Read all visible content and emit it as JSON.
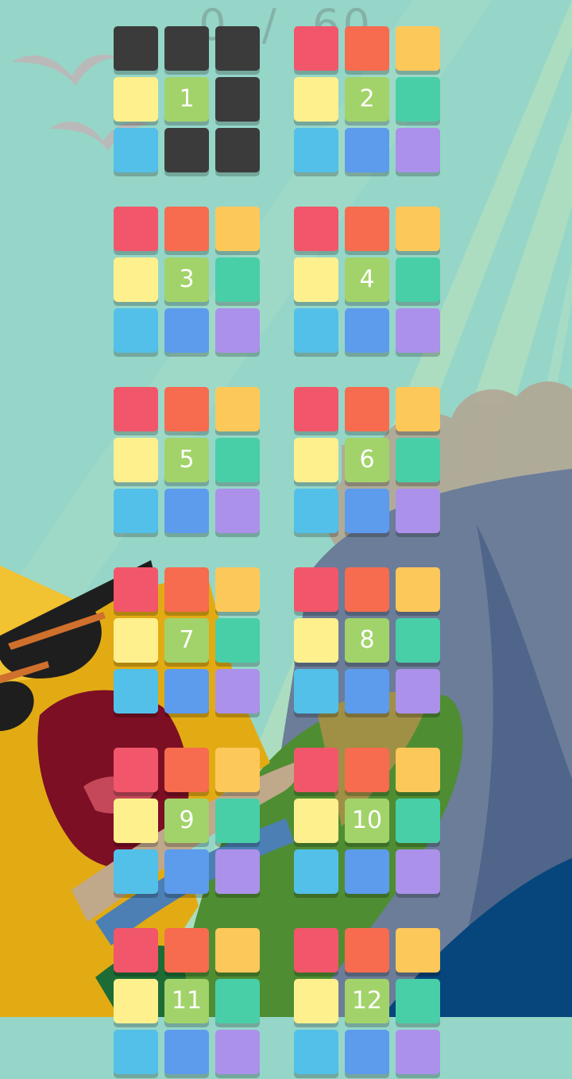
{
  "score": {
    "current": "0",
    "separator": "/",
    "total": "60"
  },
  "colors": {
    "red": "#f2566a",
    "orange": "#f76b4f",
    "amber": "#fdc85a",
    "yellow": "#fff08e",
    "green": "#a2d36a",
    "teal": "#48cfa8",
    "sky": "#52c0e8",
    "blue": "#5d9bec",
    "purple": "#ab91ea",
    "locked": "#3b3b3b"
  },
  "levels": [
    {
      "number": "1",
      "locked": true
    },
    {
      "number": "2",
      "locked": false
    },
    {
      "number": "3",
      "locked": false
    },
    {
      "number": "4",
      "locked": false
    },
    {
      "number": "5",
      "locked": false
    },
    {
      "number": "6",
      "locked": false
    },
    {
      "number": "7",
      "locked": false
    },
    {
      "number": "8",
      "locked": false
    },
    {
      "number": "9",
      "locked": false
    },
    {
      "number": "10",
      "locked": false
    },
    {
      "number": "11",
      "locked": false
    },
    {
      "number": "12",
      "locked": false
    }
  ]
}
